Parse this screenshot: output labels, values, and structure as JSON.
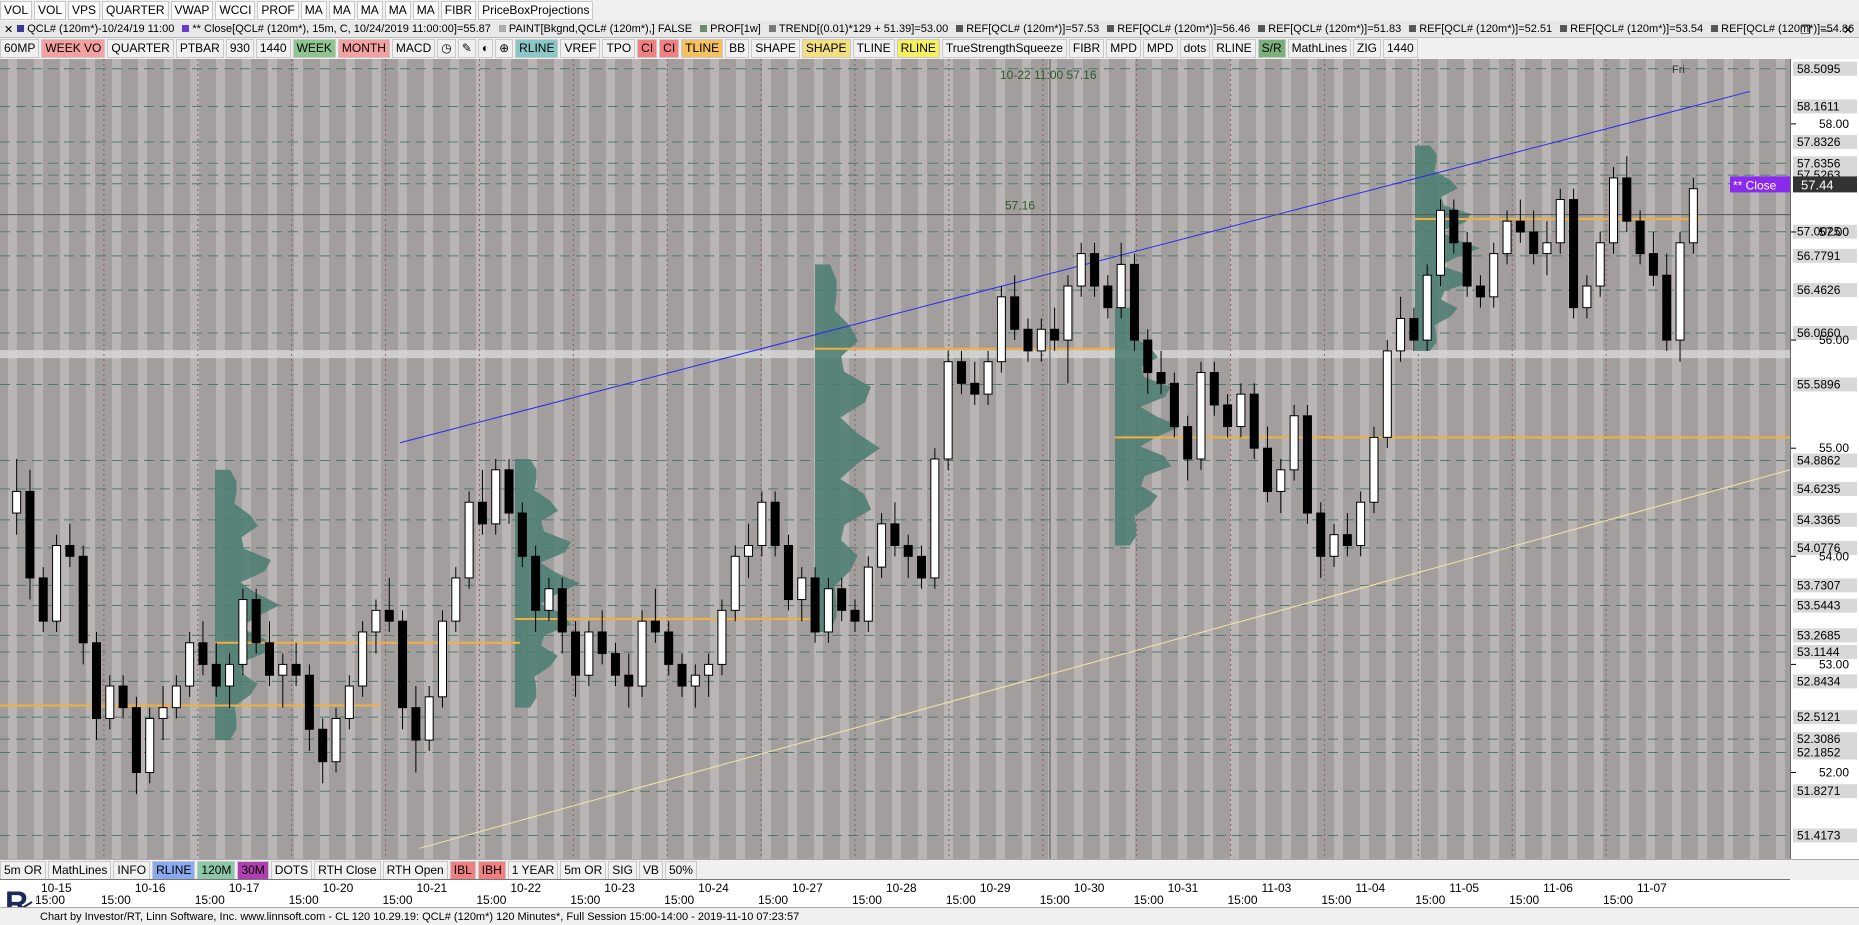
{
  "toolbar1": [
    "VOL",
    "VOL",
    "VPS",
    "QUARTER",
    "VWAP",
    "WCCI",
    "PROF",
    "MA",
    "MA",
    "MA",
    "MA",
    "MA",
    "FIBR",
    "PriceBoxProjections"
  ],
  "infobar": {
    "items": [
      {
        "text": "QCL# (120m*)-10/24/19 11:00",
        "color": "#3a3a9a"
      },
      {
        "text": "** Close[QCL# (120m*), 15m, C, 10/24/2019 11:00:00]=55.87",
        "color": "#6a3ad0"
      },
      {
        "text": "PAINT[Bkgnd,QCL# (120m*),] FALSE",
        "color": "#aaaaaa"
      },
      {
        "text": "PROF[1w]",
        "color": "#6a8a6a"
      },
      {
        "text": "TREND[(0.01)*129 + 51.39]=53.00",
        "color": "#777777"
      },
      {
        "text": "REF[QCL# (120m*)]=57.53",
        "color": "#555555"
      },
      {
        "text": "REF[QCL# (120m*)]=56.46",
        "color": "#555555"
      },
      {
        "text": "REF[QCL# (120m*)]=51.83",
        "color": "#555555"
      },
      {
        "text": "REF[QCL# (120m*)]=52.51",
        "color": "#555555"
      },
      {
        "text": "REF[QCL# (120m*)]=53.54",
        "color": "#555555"
      },
      {
        "text": "REF[QCL# (120m*)]=54.86",
        "color": "#555555"
      }
    ]
  },
  "toolbar2": [
    {
      "label": "60MP",
      "bg": "#f0f0f0"
    },
    {
      "label": "WEEK VO",
      "bg": "#f2a0a0"
    },
    {
      "label": "QUARTER",
      "bg": "#f0f0f0"
    },
    {
      "label": "PTBAR",
      "bg": "#f0f0f0"
    },
    {
      "label": "930",
      "bg": "#f0f0f0"
    },
    {
      "label": "1440",
      "bg": "#f0f0f0"
    },
    {
      "label": "WEEK",
      "bg": "#8ec48e"
    },
    {
      "label": "MONTH",
      "bg": "#f2a0a0"
    },
    {
      "label": "MACD",
      "bg": "#f0f0f0"
    },
    {
      "label": "◷",
      "bg": "#f0f0f0"
    },
    {
      "label": "✎",
      "bg": "#f0f0f0"
    },
    {
      "label": "◐",
      "bg": "#f0f0f0"
    },
    {
      "label": "⊕",
      "bg": "#f0f0f0"
    },
    {
      "label": "RLINE",
      "bg": "#8ac8c8"
    },
    {
      "label": "VREF",
      "bg": "#f0f0f0"
    },
    {
      "label": "TPO",
      "bg": "#f0f0f0"
    },
    {
      "label": "CI",
      "bg": "#f08080"
    },
    {
      "label": "CI",
      "bg": "#f08080"
    },
    {
      "label": "TLINE",
      "bg": "#f5c060"
    },
    {
      "label": "BB",
      "bg": "#f0f0f0"
    },
    {
      "label": "SHAPE",
      "bg": "#f0f0f0"
    },
    {
      "label": "SHAPE",
      "bg": "#f2e080"
    },
    {
      "label": "TLINE",
      "bg": "#f0f0f0"
    },
    {
      "label": "RLINE",
      "bg": "#f5f060"
    },
    {
      "label": "TrueStrengthSqueeze",
      "bg": "#f0f0f0"
    },
    {
      "label": "FIBR",
      "bg": "#f0f0f0"
    },
    {
      "label": "MPD",
      "bg": "#f0f0f0"
    },
    {
      "label": "MPD",
      "bg": "#f0f0f0"
    },
    {
      "label": "dots",
      "bg": "#f0f0f0"
    },
    {
      "label": "RLINE",
      "bg": "#f0f0f0"
    },
    {
      "label": "S/R",
      "bg": "#7ab07a"
    },
    {
      "label": "MathLines",
      "bg": "#f0f0f0"
    },
    {
      "label": "ZIG",
      "bg": "#f0f0f0"
    },
    {
      "label": "1440",
      "bg": "#f0f0f0"
    }
  ],
  "bottombtns": [
    {
      "label": "5m OR",
      "bg": "#f0f0f0"
    },
    {
      "label": "MathLines",
      "bg": "#f0f0f0"
    },
    {
      "label": "INFO",
      "bg": "#f0f0f0"
    },
    {
      "label": "RLINE",
      "bg": "#8aaaf0"
    },
    {
      "label": "120M",
      "bg": "#8ac8a8"
    },
    {
      "label": "30M",
      "bg": "#b040b0"
    },
    {
      "label": "DOTS",
      "bg": "#f0f0f0"
    },
    {
      "label": "RTH Close",
      "bg": "#f0f0f0"
    },
    {
      "label": "RTH Open",
      "bg": "#f0f0f0"
    },
    {
      "label": "IBL",
      "bg": "#f08080"
    },
    {
      "label": "IBH",
      "bg": "#f08080"
    },
    {
      "label": "1 YEAR",
      "bg": "#f0f0f0"
    },
    {
      "label": "5m OR",
      "bg": "#f0f0f0"
    },
    {
      "label": "SIG",
      "bg": "#f0f0f0"
    },
    {
      "label": "VB",
      "bg": "#f0f0f0"
    },
    {
      "label": "50%",
      "bg": "#f0f0f0"
    }
  ],
  "statusbar": "Chart by Investor/RT, Linn Software, Inc. www.linnsoft.com - CL 120    10.29.19: QCL# (120m*) 120 Minutes*, Full Session 15:00-14:00 - 2019-11-10 07:23:57",
  "chart_data": {
    "type": "candlestick",
    "symbol": "QCL# (120m*)",
    "crosshair_label": "10-22 11:00  57.16",
    "crosshair_price": "57.16",
    "day_label": "Fri",
    "close_label": "** Close",
    "close_value": "57.44",
    "ylim": [
      51.2,
      58.6
    ],
    "price_ticks": [
      "58.00",
      "57.00",
      "56.00",
      "55.00",
      "54.00",
      "53.00",
      "52.00"
    ],
    "reference_levels": [
      "58.5095",
      "58.1611",
      "57.8326",
      "57.6356",
      "57.5263",
      "57.4455",
      "57.0025",
      "56.7791",
      "56.4626",
      "56.0660",
      "55.5896",
      "54.8862",
      "54.6235",
      "54.3365",
      "54.0776",
      "53.7307",
      "53.5443",
      "53.2685",
      "53.1144",
      "52.8434",
      "52.5121",
      "52.3086",
      "52.1852",
      "51.8271",
      "51.4173"
    ],
    "days": [
      "10-15",
      "10-16",
      "10-17",
      "10-20",
      "10-21",
      "10-22",
      "10-23",
      "10-24",
      "10-27",
      "10-28",
      "10-29",
      "10-30",
      "10-31",
      "11-03",
      "11-04",
      "11-05",
      "11-06",
      "11-07"
    ],
    "time_label": "15:00",
    "candles": [
      [
        54.4,
        54.9,
        54.2,
        54.6
      ],
      [
        54.6,
        54.8,
        53.6,
        53.8
      ],
      [
        53.8,
        53.9,
        53.3,
        53.4
      ],
      [
        53.4,
        54.2,
        53.3,
        54.1
      ],
      [
        54.1,
        54.3,
        53.9,
        54.0
      ],
      [
        54.0,
        54.1,
        53.0,
        53.2
      ],
      [
        53.2,
        53.3,
        52.3,
        52.5
      ],
      [
        52.5,
        52.9,
        52.4,
        52.8
      ],
      [
        52.8,
        52.9,
        52.5,
        52.6
      ],
      [
        52.6,
        52.7,
        51.8,
        52.0
      ],
      [
        52.0,
        52.6,
        51.9,
        52.5
      ],
      [
        52.5,
        52.8,
        52.3,
        52.6
      ],
      [
        52.6,
        52.9,
        52.5,
        52.8
      ],
      [
        52.8,
        53.3,
        52.7,
        53.2
      ],
      [
        53.2,
        53.4,
        52.9,
        53.0
      ],
      [
        53.0,
        53.2,
        52.7,
        52.8
      ],
      [
        52.8,
        53.1,
        52.6,
        53.0
      ],
      [
        53.0,
        53.7,
        52.9,
        53.6
      ],
      [
        53.6,
        53.7,
        53.1,
        53.2
      ],
      [
        53.2,
        53.4,
        52.8,
        52.9
      ],
      [
        52.9,
        53.1,
        52.6,
        53.0
      ],
      [
        53.0,
        53.2,
        52.8,
        52.9
      ],
      [
        52.9,
        53.0,
        52.2,
        52.4
      ],
      [
        52.4,
        52.5,
        51.9,
        52.1
      ],
      [
        52.1,
        52.6,
        52.0,
        52.5
      ],
      [
        52.5,
        52.9,
        52.4,
        52.8
      ],
      [
        52.8,
        53.4,
        52.7,
        53.3
      ],
      [
        53.3,
        53.6,
        53.1,
        53.5
      ],
      [
        53.5,
        53.8,
        53.3,
        53.4
      ],
      [
        53.4,
        53.5,
        52.4,
        52.6
      ],
      [
        52.6,
        52.8,
        52.0,
        52.3
      ],
      [
        52.3,
        52.8,
        52.2,
        52.7
      ],
      [
        52.7,
        53.5,
        52.6,
        53.4
      ],
      [
        53.4,
        53.9,
        53.3,
        53.8
      ],
      [
        53.8,
        54.6,
        53.7,
        54.5
      ],
      [
        54.5,
        54.8,
        54.2,
        54.3
      ],
      [
        54.3,
        54.9,
        54.2,
        54.8
      ],
      [
        54.8,
        54.9,
        54.3,
        54.4
      ],
      [
        54.4,
        54.5,
        53.9,
        54.0
      ],
      [
        54.0,
        54.1,
        53.3,
        53.5
      ],
      [
        53.5,
        53.8,
        53.4,
        53.7
      ],
      [
        53.7,
        53.8,
        53.1,
        53.3
      ],
      [
        53.3,
        53.4,
        52.7,
        52.9
      ],
      [
        52.9,
        53.4,
        52.8,
        53.3
      ],
      [
        53.3,
        53.5,
        53.0,
        53.1
      ],
      [
        53.1,
        53.2,
        52.8,
        52.9
      ],
      [
        52.9,
        53.1,
        52.6,
        52.8
      ],
      [
        52.8,
        53.5,
        52.7,
        53.4
      ],
      [
        53.4,
        53.7,
        53.2,
        53.3
      ],
      [
        53.3,
        53.4,
        52.9,
        53.0
      ],
      [
        53.0,
        53.1,
        52.7,
        52.8
      ],
      [
        52.8,
        53.0,
        52.6,
        52.9
      ],
      [
        52.9,
        53.1,
        52.7,
        53.0
      ],
      [
        53.0,
        53.6,
        52.9,
        53.5
      ],
      [
        53.5,
        54.1,
        53.4,
        54.0
      ],
      [
        54.0,
        54.3,
        53.8,
        54.1
      ],
      [
        54.1,
        54.6,
        54.0,
        54.5
      ],
      [
        54.5,
        54.6,
        54.0,
        54.1
      ],
      [
        54.1,
        54.2,
        53.5,
        53.6
      ],
      [
        53.6,
        53.9,
        53.4,
        53.8
      ],
      [
        53.8,
        53.9,
        53.2,
        53.3
      ],
      [
        53.3,
        53.8,
        53.2,
        53.7
      ],
      [
        53.7,
        53.8,
        53.4,
        53.5
      ],
      [
        53.5,
        53.6,
        53.3,
        53.4
      ],
      [
        53.4,
        54.0,
        53.3,
        53.9
      ],
      [
        53.9,
        54.4,
        53.8,
        54.3
      ],
      [
        54.3,
        54.5,
        54.0,
        54.1
      ],
      [
        54.1,
        54.2,
        53.8,
        54.0
      ],
      [
        54.0,
        54.1,
        53.7,
        53.8
      ],
      [
        53.8,
        55.0,
        53.7,
        54.9
      ],
      [
        54.9,
        55.9,
        54.8,
        55.8
      ],
      [
        55.8,
        55.9,
        55.5,
        55.6
      ],
      [
        55.6,
        55.8,
        55.4,
        55.5
      ],
      [
        55.5,
        55.9,
        55.4,
        55.8
      ],
      [
        55.8,
        56.5,
        55.7,
        56.4
      ],
      [
        56.4,
        56.6,
        56.0,
        56.1
      ],
      [
        56.1,
        56.2,
        55.8,
        55.9
      ],
      [
        55.9,
        56.2,
        55.8,
        56.1
      ],
      [
        56.1,
        56.3,
        55.9,
        56.0
      ],
      [
        56.0,
        56.6,
        55.6,
        56.5
      ],
      [
        56.5,
        56.9,
        56.4,
        56.8
      ],
      [
        56.8,
        56.9,
        56.4,
        56.5
      ],
      [
        56.5,
        56.6,
        56.2,
        56.3
      ],
      [
        56.3,
        56.9,
        56.2,
        56.7
      ],
      [
        56.7,
        56.8,
        55.9,
        56.0
      ],
      [
        56.0,
        56.1,
        55.5,
        55.7
      ],
      [
        55.7,
        55.9,
        55.5,
        55.6
      ],
      [
        55.6,
        55.7,
        55.1,
        55.2
      ],
      [
        55.2,
        55.3,
        54.7,
        54.9
      ],
      [
        54.9,
        55.8,
        54.8,
        55.7
      ],
      [
        55.7,
        55.8,
        55.3,
        55.4
      ],
      [
        55.4,
        55.5,
        55.1,
        55.2
      ],
      [
        55.2,
        55.6,
        55.1,
        55.5
      ],
      [
        55.5,
        55.6,
        54.9,
        55.0
      ],
      [
        55.0,
        55.2,
        54.5,
        54.6
      ],
      [
        54.6,
        54.9,
        54.4,
        54.8
      ],
      [
        54.8,
        55.4,
        54.7,
        55.3
      ],
      [
        55.3,
        55.4,
        54.3,
        54.4
      ],
      [
        54.4,
        54.5,
        53.8,
        54.0
      ],
      [
        54.0,
        54.3,
        53.9,
        54.2
      ],
      [
        54.2,
        54.4,
        54.0,
        54.1
      ],
      [
        54.1,
        54.6,
        54.0,
        54.5
      ],
      [
        54.5,
        55.2,
        54.4,
        55.1
      ],
      [
        55.1,
        56.0,
        55.0,
        55.9
      ],
      [
        55.9,
        56.4,
        55.8,
        56.2
      ],
      [
        56.2,
        56.3,
        55.9,
        56.0
      ],
      [
        56.0,
        56.7,
        55.9,
        56.6
      ],
      [
        56.6,
        57.3,
        56.5,
        57.2
      ],
      [
        57.2,
        57.3,
        56.8,
        56.9
      ],
      [
        56.9,
        57.0,
        56.4,
        56.5
      ],
      [
        56.5,
        56.6,
        56.3,
        56.4
      ],
      [
        56.4,
        56.9,
        56.3,
        56.8
      ],
      [
        56.8,
        57.2,
        56.7,
        57.1
      ],
      [
        57.1,
        57.3,
        56.9,
        57.0
      ],
      [
        57.0,
        57.2,
        56.7,
        56.8
      ],
      [
        56.8,
        57.1,
        56.6,
        56.9
      ],
      [
        56.9,
        57.4,
        56.8,
        57.3
      ],
      [
        57.3,
        57.4,
        56.2,
        56.3
      ],
      [
        56.3,
        56.6,
        56.2,
        56.5
      ],
      [
        56.5,
        57.0,
        56.4,
        56.9
      ],
      [
        56.9,
        57.6,
        56.8,
        57.5
      ],
      [
        57.5,
        57.7,
        57.0,
        57.1
      ],
      [
        57.1,
        57.2,
        56.7,
        56.8
      ],
      [
        56.8,
        57.0,
        56.5,
        56.6
      ],
      [
        56.6,
        56.8,
        55.9,
        56.0
      ],
      [
        56.0,
        57.0,
        55.8,
        56.9
      ],
      [
        56.9,
        57.5,
        56.8,
        57.4
      ]
    ]
  }
}
